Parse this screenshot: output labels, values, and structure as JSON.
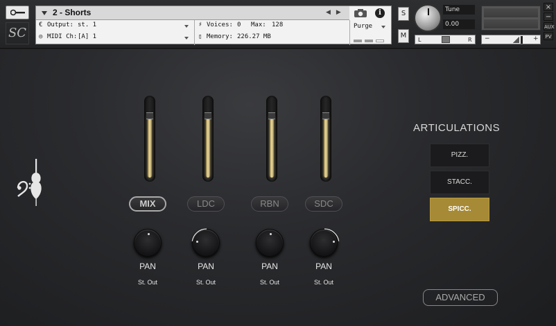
{
  "header": {
    "instrument_name": "2 - Shorts",
    "output_label": "Output:",
    "output_value": "st. 1",
    "midi_label": "MIDI Ch:",
    "midi_value": "[A]  1",
    "voices_label": "Voices:",
    "voices_value": "0",
    "max_label": "Max:",
    "max_value": "128",
    "memory_label": "Memory:",
    "memory_value": "226.27 MB",
    "purge_label": "Purge",
    "solo_label": "S",
    "mute_label": "M",
    "tune_label": "Tune",
    "tune_value": "0.00",
    "pan_left": "L",
    "pan_right": "R",
    "vol_minus": "−",
    "vol_plus": "+",
    "close_label": "×",
    "minimize_label": "−",
    "aux_label": "AUX",
    "pv_label": "PV",
    "logo_text": "SC"
  },
  "channels": [
    {
      "label": "MIX",
      "active": true,
      "level": 0.8,
      "pan_label": "PAN",
      "output": "St. Out",
      "pan": 0.0
    },
    {
      "label": "LDC",
      "active": false,
      "level": 0.8,
      "pan_label": "PAN",
      "output": "St. Out",
      "pan": -0.6
    },
    {
      "label": "RBN",
      "active": false,
      "level": 0.8,
      "pan_label": "PAN",
      "output": "St. Out",
      "pan": 0.0
    },
    {
      "label": "SDC",
      "active": false,
      "level": 0.8,
      "pan_label": "PAN",
      "output": "St. Out",
      "pan": 0.6
    }
  ],
  "articulations": {
    "title": "ARTICULATIONS",
    "items": [
      {
        "label": "PIZZ.",
        "selected": false
      },
      {
        "label": "STACC.",
        "selected": false
      },
      {
        "label": "SPICC.",
        "selected": true
      }
    ]
  },
  "advanced_label": "ADVANCED",
  "colors": {
    "accent_gold": "#a68a36",
    "fader_glow": "#f3e2a6"
  }
}
